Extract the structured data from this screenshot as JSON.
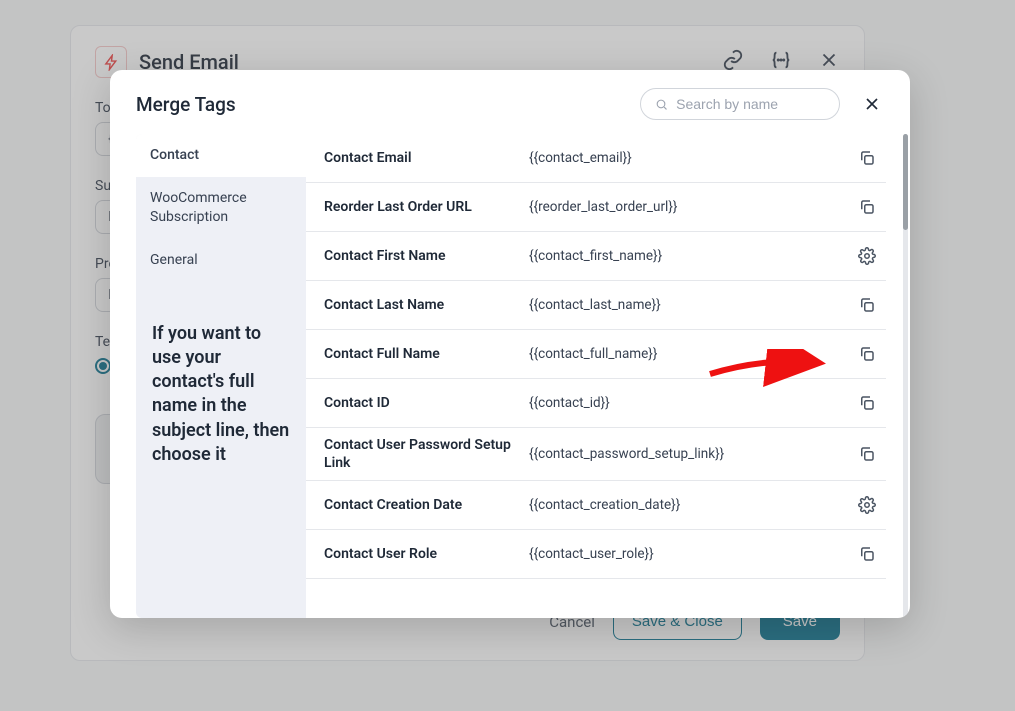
{
  "back": {
    "title": "Send Email",
    "labels": {
      "to": "To",
      "subject": "Subj",
      "preview": "Prev",
      "template": "Tem"
    },
    "inputs": {
      "to": "{{c",
      "subject": "En",
      "preview": "En"
    },
    "buttons": {
      "cancel": "Cancel",
      "save_close": "Save & Close",
      "save": "Save"
    }
  },
  "modal": {
    "title": "Merge Tags",
    "search_placeholder": "Search by name",
    "sidebar": {
      "items": [
        {
          "label": "Contact",
          "active": true
        },
        {
          "label": "WooCommerce Subscription",
          "active": false
        },
        {
          "label": "General",
          "active": false
        }
      ],
      "note": "If you want to use your contact's full name in the subject line, then choose it"
    },
    "rows": [
      {
        "name": "Contact Email",
        "code": "{{contact_email}}",
        "action": "copy"
      },
      {
        "name": "Reorder Last Order URL",
        "code": "{{reorder_last_order_url}}",
        "action": "copy"
      },
      {
        "name": "Contact First Name",
        "code": "{{contact_first_name}}",
        "action": "gear"
      },
      {
        "name": "Contact Last Name",
        "code": "{{contact_last_name}}",
        "action": "copy"
      },
      {
        "name": "Contact Full Name",
        "code": "{{contact_full_name}}",
        "action": "copy"
      },
      {
        "name": "Contact ID",
        "code": "{{contact_id}}",
        "action": "copy"
      },
      {
        "name": "Contact User Password Setup Link",
        "code": "{{contact_password_setup_link}}",
        "action": "copy"
      },
      {
        "name": "Contact Creation Date",
        "code": "{{contact_creation_date}}",
        "action": "gear"
      },
      {
        "name": "Contact User Role",
        "code": "{{contact_user_role}}",
        "action": "copy"
      }
    ]
  }
}
